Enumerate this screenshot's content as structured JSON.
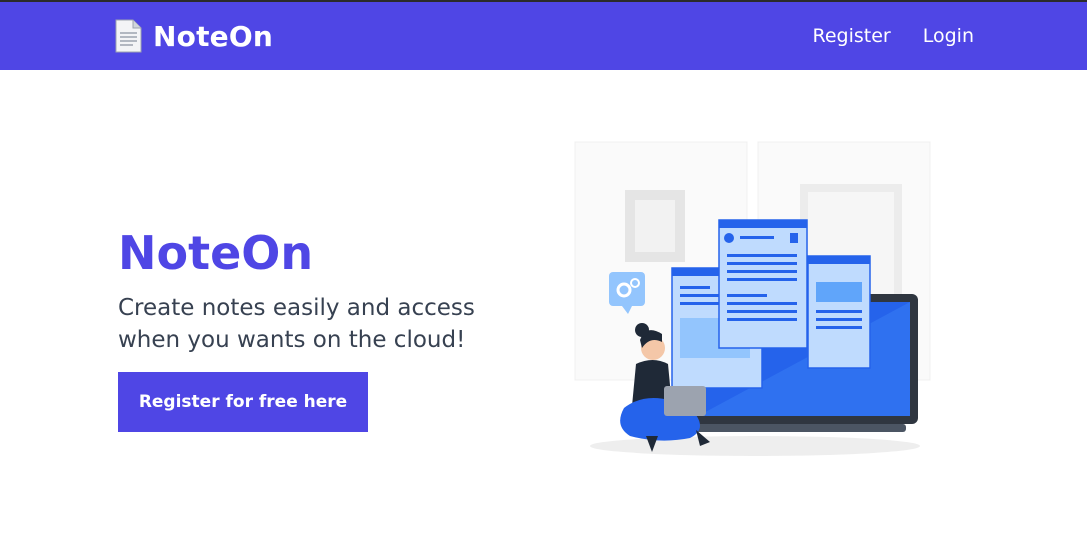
{
  "nav": {
    "brand": "NoteOn",
    "links": [
      {
        "label": "Register"
      },
      {
        "label": "Login"
      }
    ]
  },
  "hero": {
    "title": "NoteOn",
    "subtitle": "Create notes easily and access when you wants on the cloud!",
    "cta_label": "Register for free here"
  },
  "colors": {
    "brand": "#4f46e5",
    "accent_blue": "#2563eb",
    "text": "#374151"
  },
  "icons": [
    "document-icon"
  ]
}
